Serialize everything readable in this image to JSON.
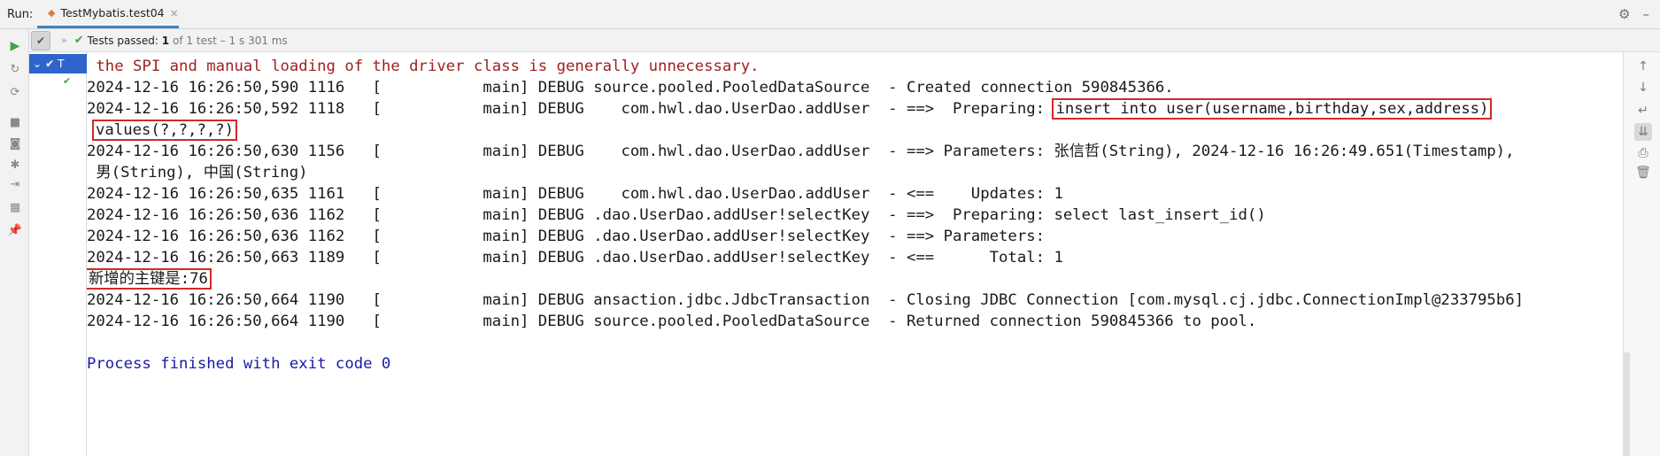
{
  "header": {
    "run_label": "Run:",
    "tab_title": "TestMybatis.test04",
    "tab_close": "×"
  },
  "status": {
    "passed_prefix": "Tests passed:",
    "passed_count": "1",
    "detail": "of 1 test – 1 s 301 ms"
  },
  "console": {
    "lines": [
      " the SPI and manual loading of the driver class is generally unnecessary.",
      "2024-12-16 16:26:50,590 1116   [           main] DEBUG source.pooled.PooledDataSource  - Created connection 590845366.",
      "2024-12-16 16:26:50,592 1118   [           main] DEBUG    com.hwl.dao.UserDao.addUser  - ==>  Preparing: ",
      "insert into user(username,birthday,sex,address)",
      "values(?,?,?,?)",
      "2024-12-16 16:26:50,630 1156   [           main] DEBUG    com.hwl.dao.UserDao.addUser  - ==> Parameters: 张信哲(String), 2024-12-16 16:26:49.651(Timestamp),",
      " 男(String), 中国(String)",
      "2024-12-16 16:26:50,635 1161   [           main] DEBUG    com.hwl.dao.UserDao.addUser  - <==    Updates: 1",
      "2024-12-16 16:26:50,636 1162   [           main] DEBUG .dao.UserDao.addUser!selectKey  - ==>  Preparing: select last_insert_id()",
      "2024-12-16 16:26:50,636 1162   [           main] DEBUG .dao.UserDao.addUser!selectKey  - ==> Parameters: ",
      "2024-12-16 16:26:50,663 1189   [           main] DEBUG .dao.UserDao.addUser!selectKey  - <==      Total: 1",
      "新增的主键是:76",
      "2024-12-16 16:26:50,664 1190   [           main] DEBUG ansaction.jdbc.JdbcTransaction  - Closing JDBC Connection [com.mysql.cj.jdbc.ConnectionImpl@233795b6]",
      "2024-12-16 16:26:50,664 1190   [           main] DEBUG source.pooled.PooledDataSource  - Returned connection 590845366 to pool.",
      "Process finished with exit code 0"
    ]
  },
  "colors": {
    "warning_text": "#a12020",
    "exit_text": "#1a1aa6",
    "highlight_box": "#d62828",
    "pass_green": "#4a9e4a",
    "selection_blue": "#2f65ca"
  },
  "icons": {
    "tab": "java-class-icon",
    "settings": "gear-icon",
    "minimize": "minimize-icon",
    "rerun": "play-icon",
    "pass": "check-icon"
  }
}
